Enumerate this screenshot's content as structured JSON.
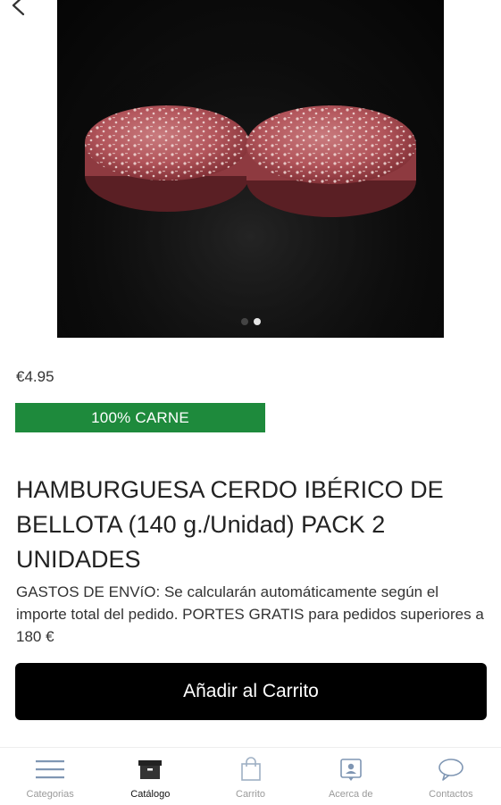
{
  "product": {
    "price": "€4.95",
    "badge": "100% CARNE",
    "title": "HAMBURGUESA CERDO IBÉRICO DE BELLOTA (140 g./Unidad) PACK 2 UNIDADES",
    "shipping_note": "GASTOS DE ENVíO:  Se calcularán automáticamente según el importe total del pedido. PORTES GRATIS para pedidos superiores a 180 €",
    "image_subject": "two raw iberico pork burger patties on black slate",
    "carousel": {
      "total": 2,
      "active": 2
    }
  },
  "actions": {
    "add_to_cart": "Añadir al Carrito"
  },
  "icons": {
    "back": "chevron-left-icon"
  },
  "tabbar": {
    "items": [
      {
        "label": "Categorias",
        "icon": "menu-lines-icon",
        "active": false
      },
      {
        "label": "Catálogo",
        "icon": "catalog-box-icon",
        "active": true
      },
      {
        "label": "Carrito",
        "icon": "shopping-bag-icon",
        "active": false
      },
      {
        "label": "Acerca de",
        "icon": "profile-card-icon",
        "active": false
      },
      {
        "label": "Contactos",
        "icon": "chat-bubble-icon",
        "active": false
      }
    ]
  },
  "colors": {
    "badge_green": "#1e8a3c",
    "cta_black": "#000000",
    "tab_inactive": "#9a9a9a",
    "tab_active": "#111111"
  }
}
